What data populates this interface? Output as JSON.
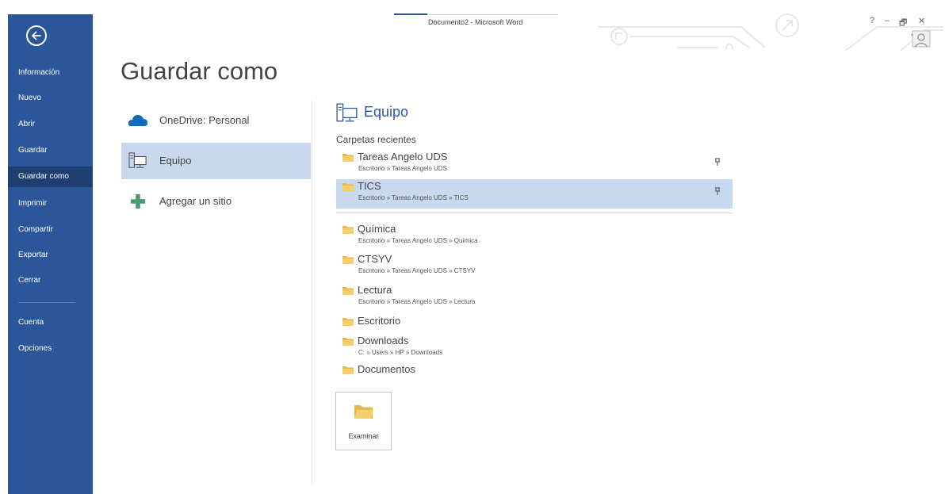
{
  "window": {
    "title": "Documento2 - Microsoft Word",
    "help": "?",
    "minimize": "–",
    "restore": "🗗",
    "close": "✕",
    "account_caret": "▾"
  },
  "nav": {
    "back_icon": "back-arrow-icon",
    "items": [
      {
        "label": "Información"
      },
      {
        "label": "Nuevo"
      },
      {
        "label": "Abrir"
      },
      {
        "label": "Guardar"
      },
      {
        "label": "Guardar como",
        "active": true
      },
      {
        "label": "Imprimir"
      },
      {
        "label": "Compartir"
      },
      {
        "label": "Exportar"
      },
      {
        "label": "Cerrar"
      },
      {
        "label": "Cuenta"
      },
      {
        "label": "Opciones"
      }
    ]
  },
  "page_title": "Guardar como",
  "places": [
    {
      "label": "OneDrive: Personal",
      "icon": "onedrive-cloud-icon"
    },
    {
      "label": "Equipo",
      "icon": "computer-icon",
      "selected": true
    },
    {
      "label": "Agregar un sitio",
      "icon": "add-plus-icon"
    }
  ],
  "pane": {
    "title": "Equipo",
    "recent_heading": "Carpetas recientes",
    "pinned": [
      {
        "name": "Tareas Angelo UDS",
        "path": "Escritorio » Tareas Angelo UDS"
      },
      {
        "name": "TICS",
        "path": "Escritorio » Tareas Angelo UDS » TICS",
        "selected": true
      }
    ],
    "recent": [
      {
        "name": "Química",
        "path": "Escritorio » Tareas Angelo UDS » Química"
      },
      {
        "name": "CTSYV",
        "path": "Escritorio » Tareas Angelo UDS » CTSYV"
      },
      {
        "name": "Lectura",
        "path": "Escritorio » Tareas Angelo UDS » Lectura"
      },
      {
        "name": "Escritorio",
        "path": ""
      },
      {
        "name": "Downloads",
        "path": "C: » Users » HP » Downloads"
      },
      {
        "name": "Documentos",
        "path": ""
      }
    ],
    "browse_label": "Examinar"
  },
  "colors": {
    "nav_bg": "#2b579a",
    "nav_active": "#1f3f73",
    "selection": "#c7d8ef",
    "folder": "#e8b84a",
    "accent": "#2b579a"
  }
}
